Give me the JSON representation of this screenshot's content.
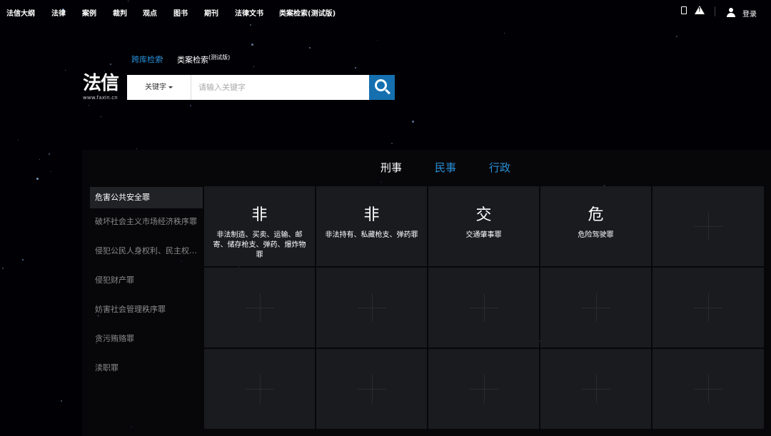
{
  "nav": {
    "items": [
      "法信大纲",
      "法律",
      "案例",
      "裁判",
      "观点",
      "图书",
      "期刊",
      "法律文书",
      "类案检索(测试版)"
    ],
    "login": "登录",
    "icons": [
      "mobile-icon",
      "warning-icon",
      "user-icon"
    ]
  },
  "search": {
    "tabs": [
      "跨库检索",
      "类案检索"
    ],
    "tab2_suffix": "(测试版)",
    "logo_main": "法信",
    "logo_sub": "www.faxin.cn",
    "select_label": "关键字",
    "placeholder": "请输入关键字",
    "button_icon": "search-icon"
  },
  "categories": {
    "tabs": [
      "刑事",
      "民事",
      "行政"
    ]
  },
  "sidebar": {
    "items": [
      "危害公共安全罪",
      "破坏社会主义市场经济秩序罪",
      "侵犯公民人身权利、民主权利罪",
      "侵犯财产罪",
      "妨害社会管理秩序罪",
      "贪污贿赂罪",
      "渎职罪"
    ]
  },
  "grid": {
    "cells": [
      {
        "glyph": "非",
        "name": "非法制造、买卖、运输、邮寄、储存枪支、弹药、爆炸物罪"
      },
      {
        "glyph": "非",
        "name": "非法持有、私藏枪支、弹药罪"
      },
      {
        "glyph": "交",
        "name": "交通肇事罪"
      },
      {
        "glyph": "危",
        "name": "危险驾驶罪"
      }
    ]
  },
  "colors": {
    "accent": "#2a8fd6",
    "search_button": "#1670b0",
    "cell_bg": "#1a1b1f",
    "sidebar_active": "#212226"
  }
}
